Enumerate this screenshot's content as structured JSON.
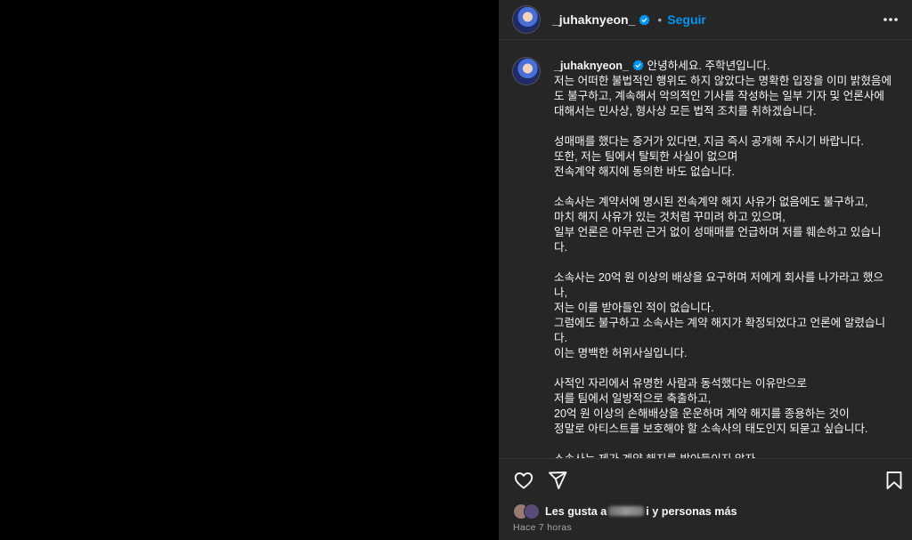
{
  "post": {
    "username": "_juhaknyeon_",
    "follow_label": "Seguir",
    "dot": "•",
    "caption": " 안녕하세요. 주학년입니다.\n저는 어떠한 불법적인 행위도 하지 않았다는 명확한 입장을 이미 밝혔음에도 불구하고, 계속해서 악의적인 기사를 작성하는 일부 기자 및 언론사에 대해서는 민사상, 형사상 모든 법적 조치를 취하겠습니다.\n\n성매매를 했다는 증거가 있다면, 지금 즉시 공개해 주시기 바랍니다.\n또한, 저는 팀에서 탈퇴한 사실이 없으며\n전속계약 해지에 동의한 바도 없습니다.\n\n소속사는 계약서에 명시된 전속계약 해지 사유가 없음에도 불구하고,\n마치 해지 사유가 있는 것처럼 꾸미려 하고 있으며,\n일부 언론은 아무런 근거 없이 성매매를 언급하며 저를 훼손하고 있습니다.\n\n소속사는 20억 원 이상의 배상을 요구하며 저에게 회사를 나가라고 했으나,\n저는 이를 받아들인 적이 없습니다.\n그럼에도 불구하고 소속사는 계약 해지가 확정되었다고 언론에 알렸습니다.\n이는 명백한 허위사실입니다.\n\n사적인 자리에서 유명한 사람과 동석했다는 이유만으로\n저를 팀에서 일방적으로 축출하고,\n20억 원 이상의 손해배상을 운운하며 계약 해지를 종용하는 것이\n정말로 아티스트를 보호해야 할 소속사의 태도인지 되묻고 싶습니다.\n\n소속사는 제가 계약 해지를 받아들이지 않자,\n계약서에 규정된 절차도 무시한 채",
    "likes_prefix": "Les gusta a",
    "likes_middle": "i",
    "likes_suffix": " y personas más",
    "timestamp": "Hace 7 horas"
  },
  "icons": {
    "verified": "verified-badge-icon",
    "more": "more-options-icon",
    "like": "heart-icon",
    "share": "send-icon",
    "save": "bookmark-icon"
  },
  "colors": {
    "accent": "#0095f6",
    "panel": "#262626",
    "media": "#000000"
  }
}
